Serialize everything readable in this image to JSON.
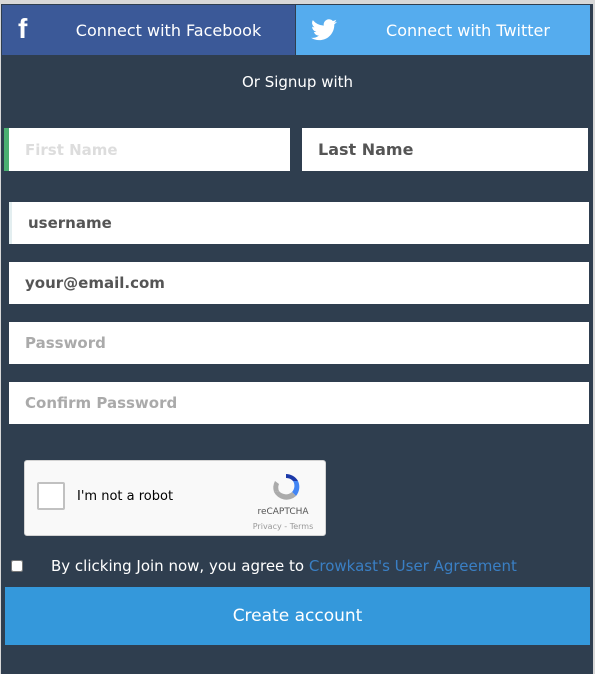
{
  "social": {
    "facebook_label": "Connect with Facebook",
    "twitter_label": "Connect with Twitter"
  },
  "divider_text": "Or Signup with",
  "fields": {
    "first_name": {
      "placeholder": "First Name",
      "value": ""
    },
    "last_name": {
      "placeholder": "Last Name",
      "value": "Last Name"
    },
    "username": {
      "placeholder": "username",
      "value": "username"
    },
    "email": {
      "placeholder": "your@email.com",
      "value": "your@email.com"
    },
    "password": {
      "placeholder": "Password",
      "value": ""
    },
    "confirm_password": {
      "placeholder": "Confirm Password",
      "value": ""
    }
  },
  "captcha": {
    "label": "I'm not a robot",
    "brand": "reCAPTCHA",
    "links": "Privacy - Terms"
  },
  "agreement": {
    "text": "By clicking Join now, you agree to ",
    "link": "Crowkast's User Agreement"
  },
  "create_label": "Create account",
  "colors": {
    "facebook": "#3b5998",
    "twitter": "#55acee",
    "background": "#2f3e4f",
    "primary": "#3498db",
    "link": "#3a7fc4"
  }
}
